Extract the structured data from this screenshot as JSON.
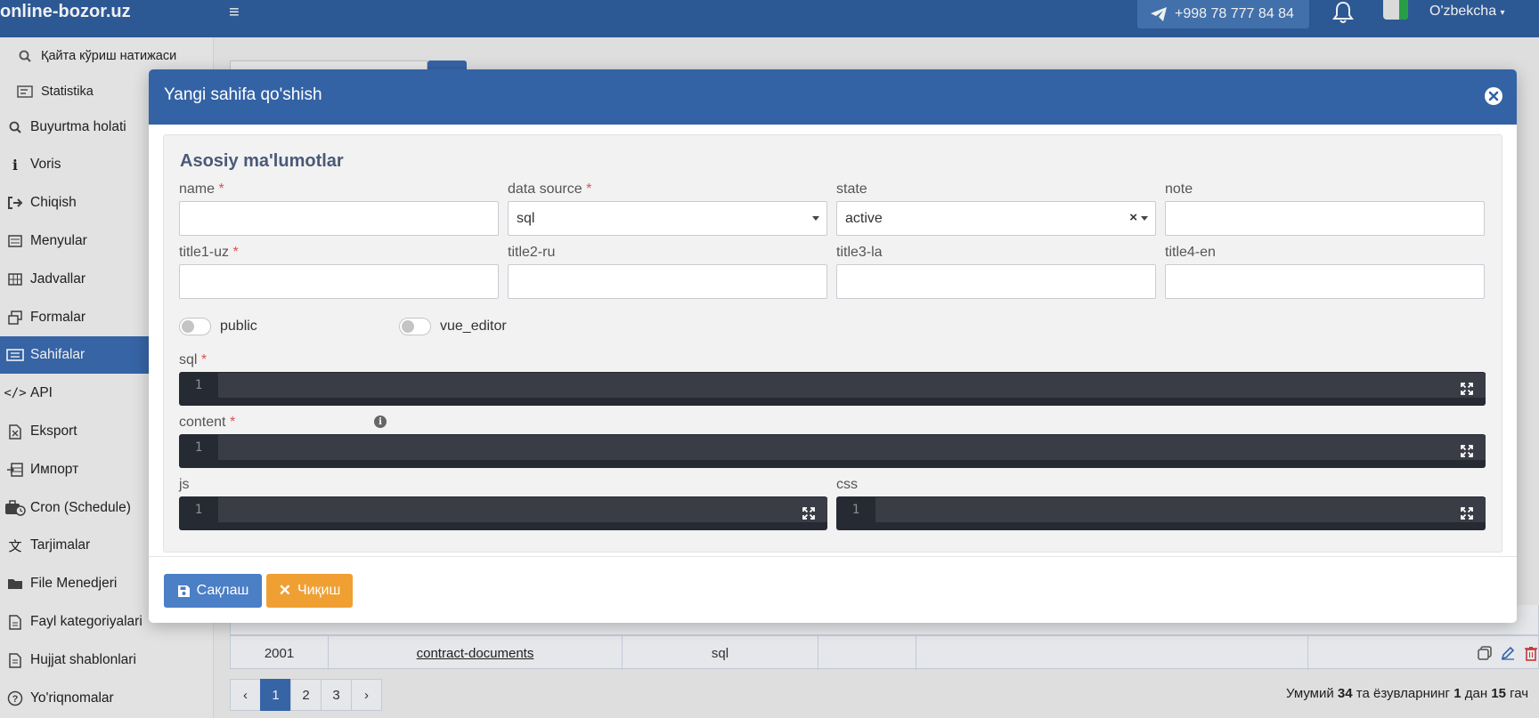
{
  "topbar": {
    "brand": "online-bozor.uz",
    "phone": "+998 78 777 84 84",
    "language": "O'zbekcha"
  },
  "sidebar": {
    "items": [
      {
        "label": "Қайта кўриш натижаси",
        "icon": "search-refresh-icon"
      },
      {
        "label": "Statistika",
        "icon": "statistics-icon"
      },
      {
        "label": "Buyurtma holati",
        "icon": "order-search-icon"
      },
      {
        "label": "Voris",
        "icon": "info-icon"
      },
      {
        "label": "Chiqish",
        "icon": "sign-out-icon"
      },
      {
        "label": "Menyular",
        "icon": "list-icon"
      },
      {
        "label": "Jadvallar",
        "icon": "table-icon"
      },
      {
        "label": "Formalar",
        "icon": "forms-icon"
      },
      {
        "label": "Sahifalar",
        "icon": "pages-icon"
      },
      {
        "label": "API",
        "icon": "code-icon"
      },
      {
        "label": "Eksport",
        "icon": "export-icon"
      },
      {
        "label": "Импорт",
        "icon": "import-icon"
      },
      {
        "label": "Cron (Schedule)",
        "icon": "briefcase-clock-icon"
      },
      {
        "label": "Tarjimalar",
        "icon": "translate-icon"
      },
      {
        "label": "File Menedjeri",
        "icon": "folder-icon"
      },
      {
        "label": "Fayl kategoriyalari",
        "icon": "file-icon"
      },
      {
        "label": "Hujjat shablonlari",
        "icon": "document-template-icon"
      },
      {
        "label": "Yo'riqnomalar",
        "icon": "help-icon"
      }
    ],
    "active_index": 8
  },
  "table": {
    "row": {
      "id": "2001",
      "name": "contract-documents",
      "source": "sql",
      "state": "",
      "note": ""
    }
  },
  "pagination": {
    "pages": [
      "1",
      "2",
      "3"
    ],
    "current": "1",
    "total_prefix": "Умумий",
    "total_count": "34",
    "total_mid": "та ёзувларнинг",
    "range_from": "1",
    "range_mid": "дан",
    "range_to": "15",
    "total_suffix": "гач"
  },
  "modal": {
    "title": "Yangi sahifa qo'shish",
    "section_title": "Asosiy ma'lumotlar",
    "fields": {
      "name": {
        "label": "name",
        "required": "*",
        "value": ""
      },
      "data_source": {
        "label": "data source",
        "required": "*",
        "value": "sql"
      },
      "state": {
        "label": "state",
        "value": "active",
        "clear": "×"
      },
      "note": {
        "label": "note",
        "value": ""
      },
      "title1": {
        "label": "title1-uz",
        "required": "*",
        "value": ""
      },
      "title2": {
        "label": "title2-ru",
        "value": ""
      },
      "title3": {
        "label": "title3-la",
        "value": ""
      },
      "title4": {
        "label": "title4-en",
        "value": ""
      }
    },
    "toggles": {
      "public": {
        "label": "public",
        "on": false
      },
      "vue_editor": {
        "label": "vue_editor",
        "on": false
      }
    },
    "editors": {
      "sql": {
        "label": "sql",
        "required": "*",
        "line": "1"
      },
      "content": {
        "label": "content",
        "required": "*",
        "line": "1"
      },
      "js": {
        "label": "js",
        "line": "1"
      },
      "css": {
        "label": "css",
        "line": "1"
      }
    },
    "buttons": {
      "save": "Сақлаш",
      "exit": "Чиқиш"
    }
  },
  "colors": {
    "primary": "#3463a5",
    "save": "#4b7fc6",
    "exit": "#f0a033",
    "required": "#d9534f",
    "editor_bg": "#262a33"
  }
}
